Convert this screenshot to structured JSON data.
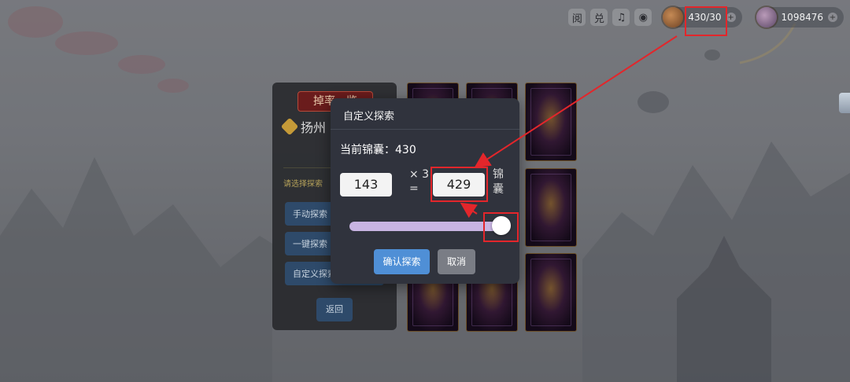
{
  "topbar": {
    "icons": [
      "news-icon",
      "exchange-icon",
      "music-icon",
      "eye-icon"
    ],
    "icon_glyphs": [
      "阅",
      "兑",
      "♫",
      "◉"
    ],
    "pouch_count": "430/30",
    "currency_amount": "1098476",
    "plus": "+"
  },
  "left_panel": {
    "title": "掉率一览",
    "location": "扬州",
    "hint": "请选择探索",
    "buttons": [
      "手动探索",
      "一键探索",
      "自定义探索"
    ],
    "back": "返回"
  },
  "dialog": {
    "title": "自定义探索",
    "current_label": "当前锦囊：430",
    "quantity_value": "143",
    "multiplier": "× 3",
    "equals": "=",
    "total_value": "429",
    "unit": "锦囊",
    "slider_fraction": 1.0,
    "confirm": "确认探索",
    "cancel": "取消"
  },
  "colors": {
    "annotation": "#e3262b",
    "confirm_button": "#4f8fd6",
    "cancel_button": "#7a7d85",
    "slider_track": "#c8b4e2",
    "dialog_bg": "#30333d"
  }
}
